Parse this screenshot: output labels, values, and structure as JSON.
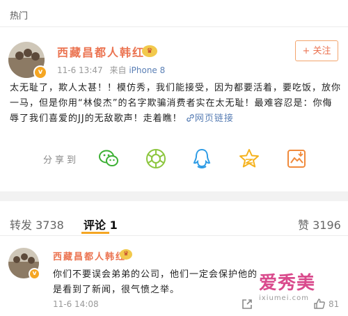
{
  "header": {
    "section_title": "热门"
  },
  "post": {
    "username": "西藏昌都人韩红",
    "timestamp": "11-6 13:47",
    "source_prefix": "来自",
    "source": "iPhone 8",
    "follow_label": "+ 关注",
    "text": "太无耻了，欺人太甚！！模仿秀，我们能接受，因为都要活着，要吃饭，放你一马，但是你用“林俊杰”的名字欺骗消费者实在太无耻！最难容忍是：你侮辱了我们喜爱的JJ的无敌歌声！走着瞧！",
    "web_link_label": "网页链接"
  },
  "share": {
    "label": "分享到",
    "icons": [
      "wechat-icon",
      "moments-icon",
      "qq-icon",
      "qzone-icon",
      "save-image-icon"
    ],
    "colors": {
      "wechat": "#3cb034",
      "moments": "#8cc63e",
      "qq": "#2d9be5",
      "qzone": "#f5b21d",
      "save": "#f08a3c"
    }
  },
  "tabs": {
    "repost_label": "转发",
    "repost_count": "3738",
    "comment_label": "评论",
    "comment_count": "1",
    "like_label": "赞",
    "like_count": "3196"
  },
  "comment": {
    "username": "西藏昌都人韩红",
    "text_line1": "你们不要误会弟弟的公司，他们一定会保护他的",
    "text_line2": "是看到了新闻，很气愤之举。",
    "timestamp": "11-6 14:08",
    "like_count": "81"
  },
  "watermark": {
    "logo_text": "爱秀美",
    "url": "ixiumei.com"
  },
  "colors": {
    "accent": "#eb7350",
    "link": "#5a7fb5",
    "tab_underline": "#f5a623",
    "vip": "#f5a623"
  }
}
